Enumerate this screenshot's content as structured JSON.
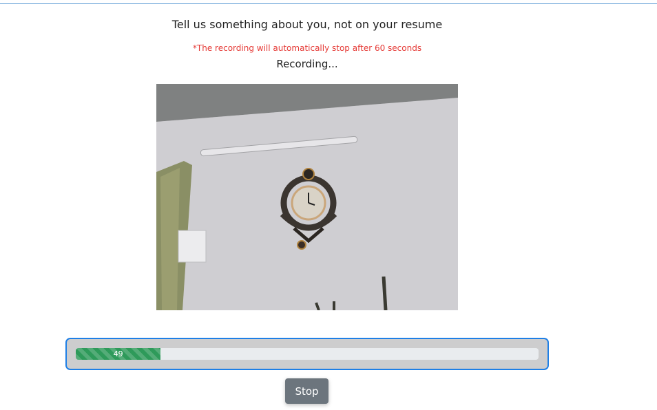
{
  "prompt": {
    "question": "Tell us something about you, not on your resume",
    "note": "*The recording will automatically stop after 60 seconds",
    "status": "Recording..."
  },
  "video": {
    "label": "webcam-preview"
  },
  "progress": {
    "value": 49,
    "label": "49",
    "max": 60,
    "bar_color": "#2e9a5a",
    "panel_border_color": "#1e7fe6"
  },
  "controls": {
    "stop_label": "Stop"
  }
}
